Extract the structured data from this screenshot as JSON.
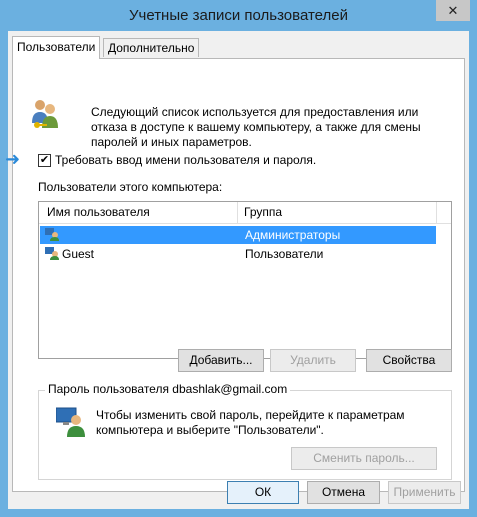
{
  "window": {
    "title": "Учетные записи пользователей",
    "close_symbol": "✕"
  },
  "tabs": [
    {
      "label": "Пользователи"
    },
    {
      "label": "Дополнительно"
    }
  ],
  "intro_text": "Следующий список используется для предоставления или отказа в доступе к вашему компьютеру, а также для смены паролей и иных параметров.",
  "require_login": {
    "label": "Требовать ввод имени пользователя и пароля.",
    "checked": true,
    "mark": "✔"
  },
  "users_label": "Пользователи этого компьютера:",
  "table": {
    "columns": [
      "Имя пользователя",
      "Группа"
    ],
    "rows": [
      {
        "name": "",
        "group": "Администраторы",
        "selected": true
      },
      {
        "name": "Guest",
        "group": "Пользователи",
        "selected": false
      }
    ]
  },
  "buttons": {
    "add": "Добавить...",
    "remove": "Удалить",
    "properties": "Свойства",
    "change_password": "Сменить пароль...",
    "ok": "ОК",
    "cancel": "Отмена",
    "apply": "Применить"
  },
  "password_group": {
    "title": "Пароль пользователя dbashlak@gmail.com",
    "text": "Чтобы изменить свой пароль, перейдите к параметрам компьютера и выберите \"Пользователи\"."
  },
  "colors": {
    "frame": "#6bb0e0",
    "selection": "#3399ff",
    "arrow": "#2b8ad9"
  }
}
